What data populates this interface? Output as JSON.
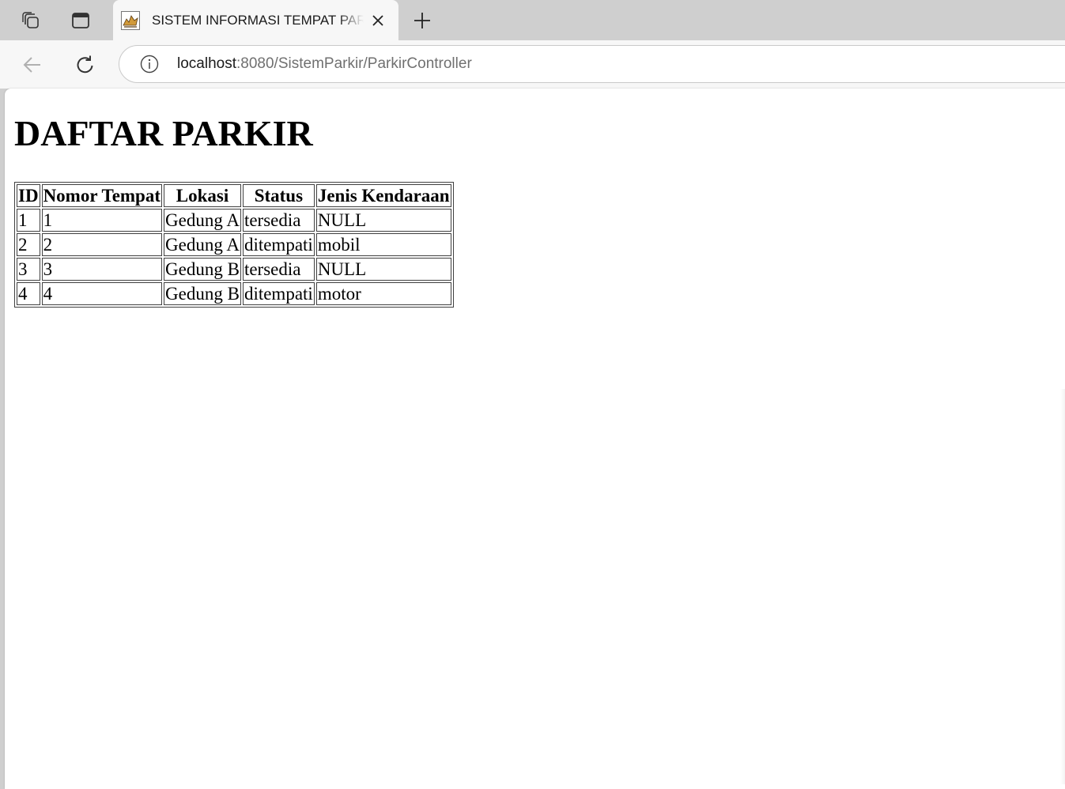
{
  "browser": {
    "tab_title": "SISTEM INFORMASI TEMPAT PARKIR",
    "url_host": "localhost",
    "url_rest": ":8080/SistemParkir/ParkirController"
  },
  "page": {
    "heading": "DAFTAR PARKIR",
    "table": {
      "headers": [
        "ID",
        "Nomor Tempat",
        "Lokasi",
        "Status",
        "Jenis Kendaraan"
      ],
      "rows": [
        [
          "1",
          "1",
          "Gedung A",
          "tersedia",
          "NULL"
        ],
        [
          "2",
          "2",
          "Gedung A",
          "ditempati",
          "mobil"
        ],
        [
          "3",
          "3",
          "Gedung B",
          "tersedia",
          "NULL"
        ],
        [
          "4",
          "4",
          "Gedung B",
          "ditempati",
          "motor"
        ]
      ]
    }
  },
  "icons": {
    "workspaces": "workspaces-icon",
    "tab_actions": "tab-actions-icon",
    "favicon": "tomcat-favicon-icon",
    "close": "close-icon",
    "new_tab": "plus-icon",
    "back": "back-arrow-icon",
    "refresh": "refresh-icon",
    "info": "info-icon"
  }
}
